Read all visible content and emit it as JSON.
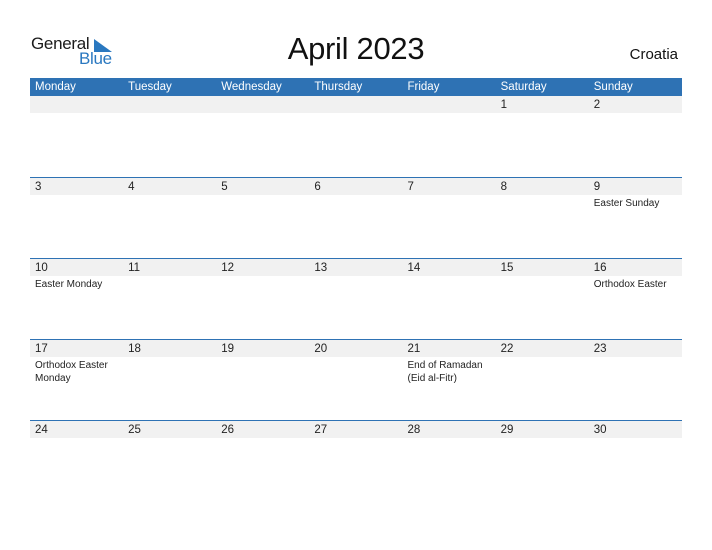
{
  "logo": {
    "line1": "General",
    "line2": "Blue"
  },
  "title": "April 2023",
  "country": "Croatia",
  "colors": {
    "accent": "#2e72b4",
    "date_bar": "#f1f1f1",
    "logo_blue": "#2a78c0"
  },
  "weekdays": [
    "Monday",
    "Tuesday",
    "Wednesday",
    "Thursday",
    "Friday",
    "Saturday",
    "Sunday"
  ],
  "weeks": [
    {
      "days": [
        {
          "num": "",
          "holiday": ""
        },
        {
          "num": "",
          "holiday": ""
        },
        {
          "num": "",
          "holiday": ""
        },
        {
          "num": "",
          "holiday": ""
        },
        {
          "num": "",
          "holiday": ""
        },
        {
          "num": "1",
          "holiday": ""
        },
        {
          "num": "2",
          "holiday": ""
        }
      ]
    },
    {
      "days": [
        {
          "num": "3",
          "holiday": ""
        },
        {
          "num": "4",
          "holiday": ""
        },
        {
          "num": "5",
          "holiday": ""
        },
        {
          "num": "6",
          "holiday": ""
        },
        {
          "num": "7",
          "holiday": ""
        },
        {
          "num": "8",
          "holiday": ""
        },
        {
          "num": "9",
          "holiday": "Easter Sunday"
        }
      ]
    },
    {
      "days": [
        {
          "num": "10",
          "holiday": "Easter Monday"
        },
        {
          "num": "11",
          "holiday": ""
        },
        {
          "num": "12",
          "holiday": ""
        },
        {
          "num": "13",
          "holiday": ""
        },
        {
          "num": "14",
          "holiday": ""
        },
        {
          "num": "15",
          "holiday": ""
        },
        {
          "num": "16",
          "holiday": "Orthodox Easter"
        }
      ]
    },
    {
      "days": [
        {
          "num": "17",
          "holiday": "Orthodox Easter Monday"
        },
        {
          "num": "18",
          "holiday": ""
        },
        {
          "num": "19",
          "holiday": ""
        },
        {
          "num": "20",
          "holiday": ""
        },
        {
          "num": "21",
          "holiday": "End of Ramadan (Eid al-Fitr)"
        },
        {
          "num": "22",
          "holiday": ""
        },
        {
          "num": "23",
          "holiday": ""
        }
      ]
    },
    {
      "days": [
        {
          "num": "24",
          "holiday": ""
        },
        {
          "num": "25",
          "holiday": ""
        },
        {
          "num": "26",
          "holiday": ""
        },
        {
          "num": "27",
          "holiday": ""
        },
        {
          "num": "28",
          "holiday": ""
        },
        {
          "num": "29",
          "holiday": ""
        },
        {
          "num": "30",
          "holiday": ""
        }
      ]
    }
  ]
}
